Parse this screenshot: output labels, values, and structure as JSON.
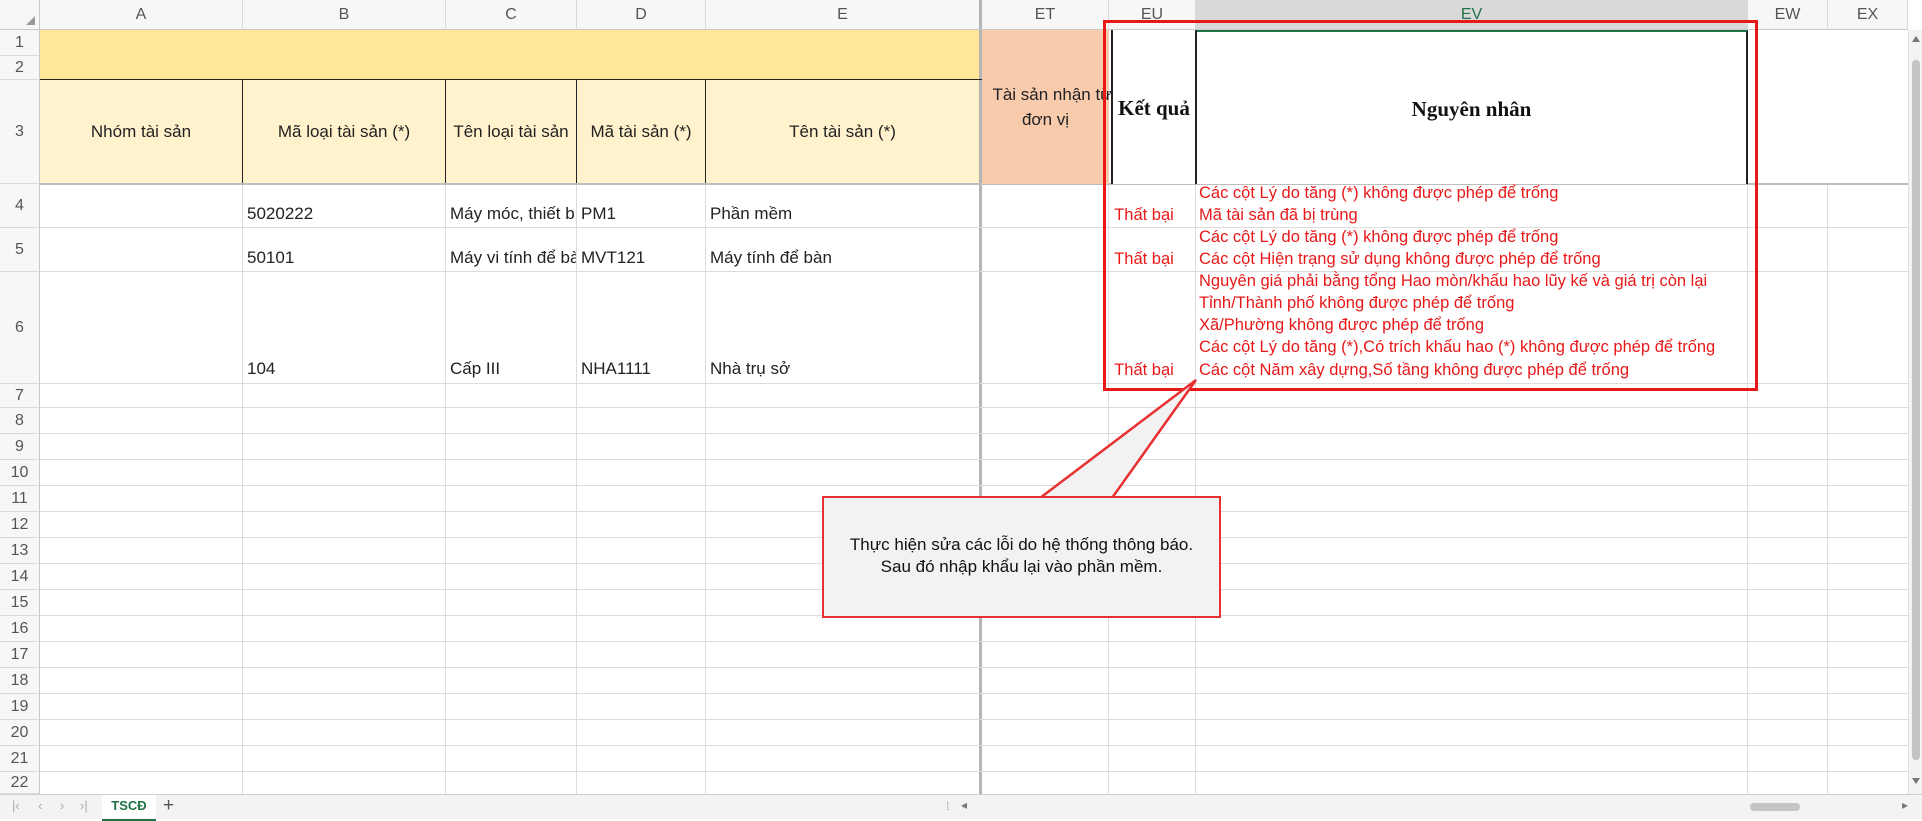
{
  "columns": [
    "A",
    "B",
    "C",
    "D",
    "E",
    "ET",
    "EU",
    "EV",
    "EW",
    "EX"
  ],
  "rows": [
    "1",
    "2",
    "3",
    "4",
    "5",
    "6",
    "7",
    "8",
    "9",
    "10",
    "11",
    "12",
    "13",
    "14",
    "15",
    "16",
    "17",
    "18",
    "19",
    "20",
    "21",
    "22"
  ],
  "header": {
    "a": "Nhóm tài sản",
    "b": "Mã loại tài sản (*)",
    "c": "Tên loại tài sản",
    "d": "Mã tài sản (*)",
    "e": "Tên tài sản (*)",
    "et_line1": "Tài sản nhận từ",
    "et_line2": "đơn vị",
    "eu": "Kết quả",
    "ev": "Nguyên nhân"
  },
  "data_rows": [
    {
      "b": "5020222",
      "c": "Máy móc, thiết b",
      "d": "PM1",
      "e": "Phần mềm",
      "result": "Thất bại",
      "errors": [
        "Các cột Lý do tăng (*) không được phép để trống",
        "Mã tài sản đã bị trùng"
      ]
    },
    {
      "b": "50101",
      "c": "Máy vi tính để bà",
      "d": "MVT121",
      "e": "Máy tính để bàn",
      "result": "Thất bại",
      "errors": [
        "Các cột Lý do tăng (*) không được phép để trống",
        "Các cột Hiện trạng sử dụng không được phép để trống"
      ]
    },
    {
      "b": "104",
      "c": "Cấp III",
      "d": "NHA1111",
      "e": "Nhà trụ sở",
      "result": "Thất bại",
      "errors": [
        "Nguyên giá phải bằng tổng Hao mòn/khấu hao lũy kế và giá trị còn lại",
        "Tỉnh/Thành phố không được phép để trống",
        "Xã/Phường không được phép để trống",
        "Các cột Lý do tăng (*),Có trích khấu hao (*) không được phép để trống",
        "Các cột Năm xây dựng,Số tầng không được phép để trống"
      ]
    }
  ],
  "callout": {
    "line1": "Thực hiện sửa các lỗi do hệ thống thông báo.",
    "line2": "Sau đó nhập khẩu lại vào phần mềm."
  },
  "sheet_tab": "TSCĐ",
  "add_sheet": "+",
  "colors": {
    "accent_red": "#e81818",
    "header_fill": "#fff2cc",
    "title_fill": "#ffe699",
    "et_fill": "#f8cbad",
    "tab_green": "#217346"
  }
}
